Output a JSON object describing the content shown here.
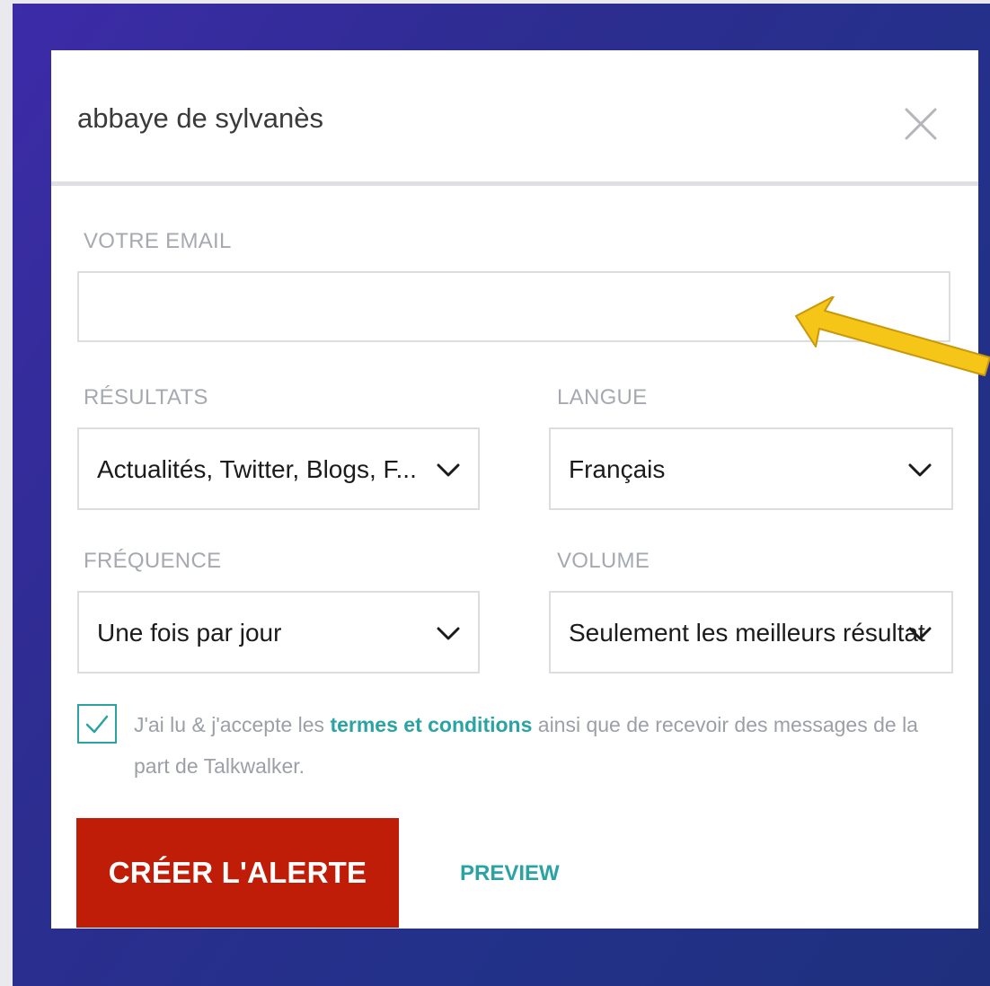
{
  "modal": {
    "title": "abbaye de sylvanès"
  },
  "form": {
    "email_label": "VOTRE EMAIL",
    "email_value": "",
    "results_label": "RÉSULTATS",
    "results_value": "Actualités, Twitter, Blogs, F...",
    "language_label": "LANGUE",
    "language_value": "Français",
    "frequency_label": "FRÉQUENCE",
    "frequency_value": "Une fois par jour",
    "volume_label": "VOLUME",
    "volume_value": "Seulement les meilleurs résultat",
    "terms_checked": true,
    "terms_prefix": "J'ai lu & j'accepte les ",
    "terms_link": "termes et conditions",
    "terms_suffix": " ainsi que de recevoir des messages de la part de Talkwalker."
  },
  "actions": {
    "create_label": "CRÉER L'ALERTE",
    "preview_label": "PREVIEW"
  },
  "icons": {
    "close": "close-icon",
    "chevron": "chevron-down-icon",
    "check": "checkmark-icon",
    "annotation": "arrow-annotation"
  },
  "colors": {
    "accent": "#2aa3a3",
    "primary_button": "#bf1d08",
    "backdrop": "#2c2d8f",
    "arrow": "#f5c518"
  }
}
